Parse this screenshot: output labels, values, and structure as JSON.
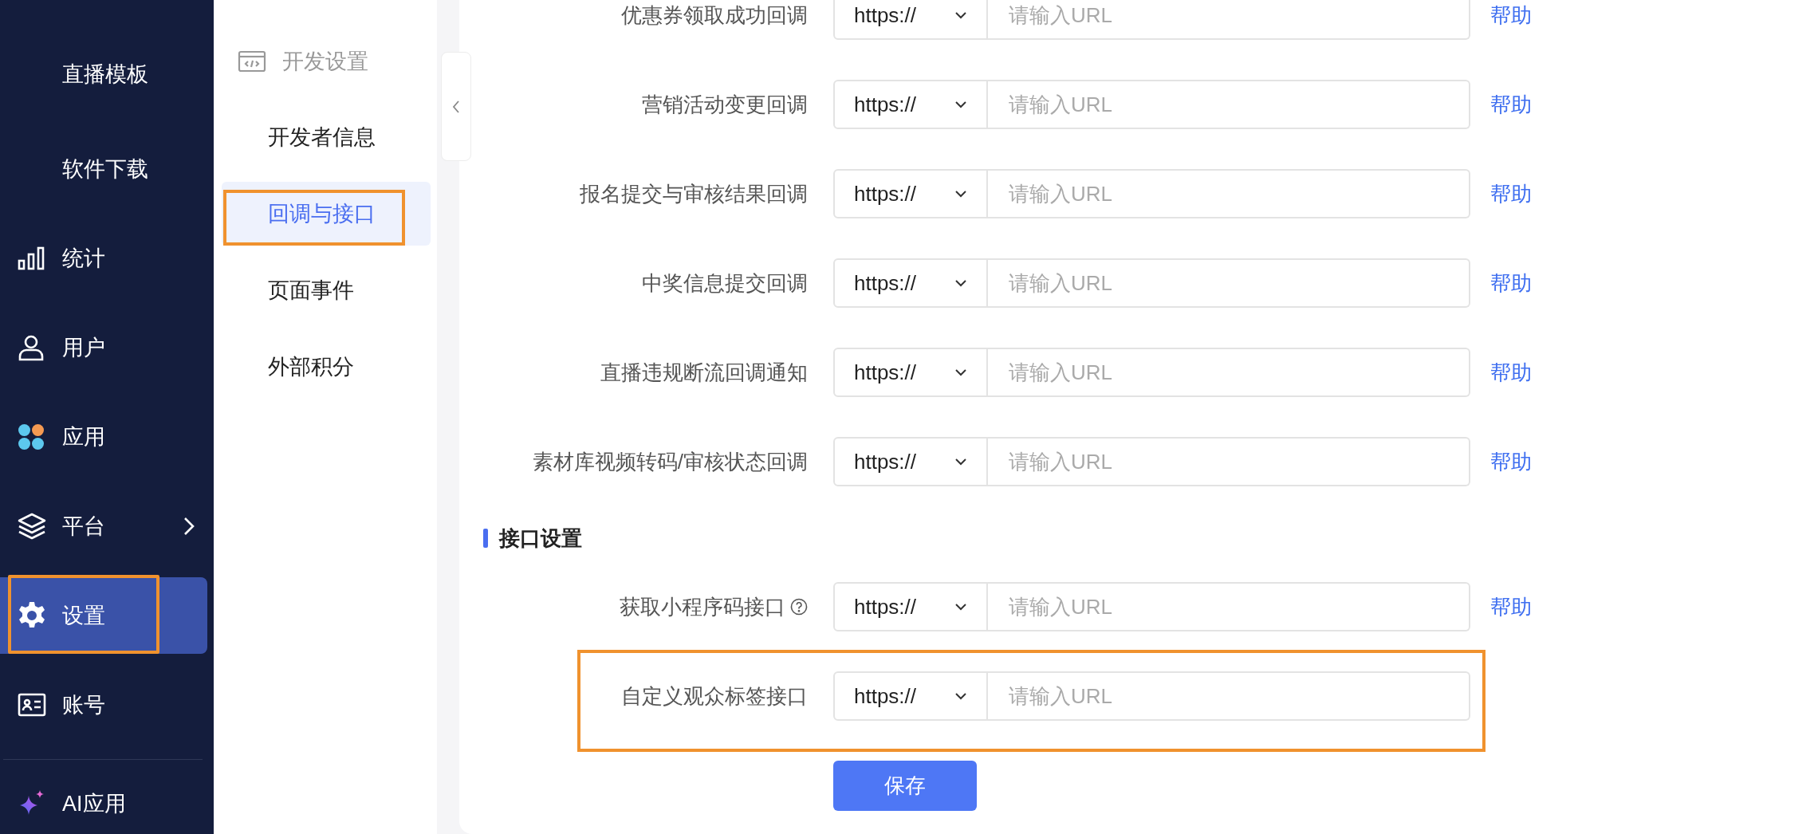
{
  "sidebar": {
    "items": [
      {
        "label": "直播模板",
        "selected": false,
        "expandable": false,
        "highlighted": false
      },
      {
        "label": "软件下载",
        "selected": false,
        "expandable": false,
        "highlighted": false
      },
      {
        "label": "统计",
        "selected": false,
        "expandable": false,
        "highlighted": false
      },
      {
        "label": "用户",
        "selected": false,
        "expandable": false,
        "highlighted": false
      },
      {
        "label": "应用",
        "selected": false,
        "expandable": false,
        "highlighted": false
      },
      {
        "label": "平台",
        "selected": false,
        "expandable": true,
        "highlighted": false
      },
      {
        "label": "设置",
        "selected": true,
        "expandable": false,
        "highlighted": true
      },
      {
        "label": "账号",
        "selected": false,
        "expandable": false,
        "highlighted": false
      }
    ],
    "footer_item": {
      "label": "AI应用"
    }
  },
  "subnav": {
    "title": "开发设置",
    "items": [
      {
        "label": "开发者信息",
        "selected": false,
        "highlighted": false
      },
      {
        "label": "回调与接口",
        "selected": true,
        "highlighted": true
      },
      {
        "label": "页面事件",
        "selected": false,
        "highlighted": false
      },
      {
        "label": "外部积分",
        "selected": false,
        "highlighted": false
      }
    ]
  },
  "form": {
    "sections": [
      {
        "rows": [
          {
            "label": "优惠券领取成功回调",
            "protocol": "https://",
            "placeholder": "请输入URL",
            "help": "帮助",
            "info": false,
            "highlighted": false
          },
          {
            "label": "营销活动变更回调",
            "protocol": "https://",
            "placeholder": "请输入URL",
            "help": "帮助",
            "info": false,
            "highlighted": false
          },
          {
            "label": "报名提交与审核结果回调",
            "protocol": "https://",
            "placeholder": "请输入URL",
            "help": "帮助",
            "info": false,
            "highlighted": false
          },
          {
            "label": "中奖信息提交回调",
            "protocol": "https://",
            "placeholder": "请输入URL",
            "help": "帮助",
            "info": false,
            "highlighted": false
          },
          {
            "label": "直播违规断流回调通知",
            "protocol": "https://",
            "placeholder": "请输入URL",
            "help": "帮助",
            "info": false,
            "highlighted": false
          },
          {
            "label": "素材库视频转码/审核状态回调",
            "protocol": "https://",
            "placeholder": "请输入URL",
            "help": "帮助",
            "info": false,
            "highlighted": false
          }
        ]
      },
      {
        "title": "接口设置",
        "rows": [
          {
            "label": "获取小程序码接口",
            "protocol": "https://",
            "placeholder": "请输入URL",
            "help": "帮助",
            "info": true,
            "highlighted": false
          },
          {
            "label": "自定义观众标签接口",
            "protocol": "https://",
            "placeholder": "请输入URL",
            "info": false,
            "highlighted": true
          }
        ]
      }
    ],
    "save_button": "保存"
  }
}
